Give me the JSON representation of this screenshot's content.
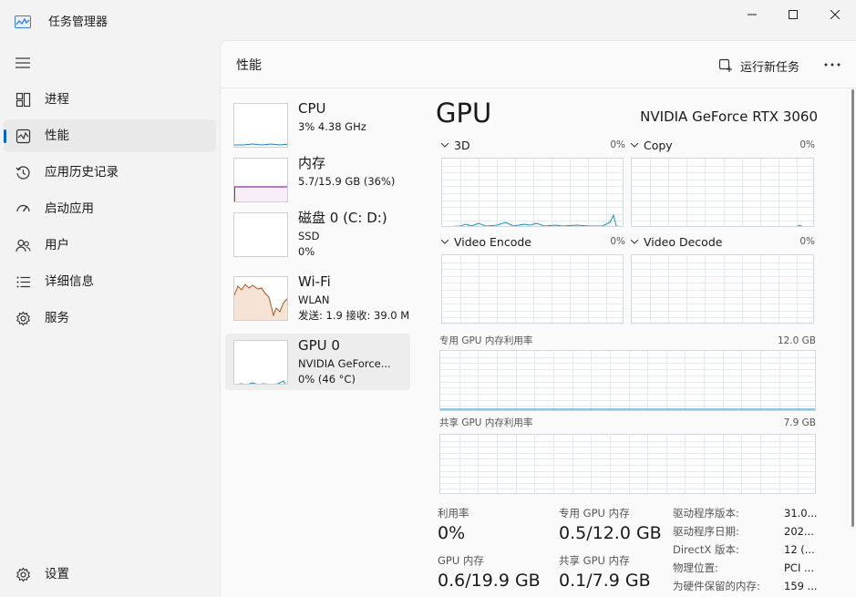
{
  "window": {
    "title": "任务管理器"
  },
  "sidebar": {
    "items": [
      {
        "label": "进程",
        "icon": "processes-icon"
      },
      {
        "label": "性能",
        "icon": "performance-icon",
        "active": true
      },
      {
        "label": "应用历史记录",
        "icon": "app-history-icon"
      },
      {
        "label": "启动应用",
        "icon": "startup-apps-icon"
      },
      {
        "label": "用户",
        "icon": "users-icon"
      },
      {
        "label": "详细信息",
        "icon": "details-icon"
      },
      {
        "label": "服务",
        "icon": "services-icon"
      }
    ],
    "settings_label": "设置"
  },
  "header": {
    "title": "性能",
    "run_task_label": "运行新任务"
  },
  "devices": [
    {
      "name": "CPU",
      "sub1": "3%  4.38 GHz",
      "sub2": "",
      "color": "#1f7fb8"
    },
    {
      "name": "内存",
      "sub1": "5.7/15.9 GB (36%)",
      "sub2": "",
      "color": "#8b2fa8"
    },
    {
      "name": "磁盘 0 (C: D:)",
      "sub1": "SSD",
      "sub2": "0%",
      "color": "#4c9a2a"
    },
    {
      "name": "Wi-Fi",
      "sub1": "WLAN",
      "sub2": "发送: 1.9  接收: 39.0 M",
      "color": "#a6541e"
    },
    {
      "name": "GPU 0",
      "sub1": "NVIDIA GeForce...",
      "sub2": "0% (46 °C)",
      "color": "#1f8fb8",
      "selected": true
    }
  ],
  "gpu": {
    "title": "GPU",
    "model": "NVIDIA GeForce RTX 3060",
    "engines": [
      {
        "name": "3D",
        "percent": "0%"
      },
      {
        "name": "Copy",
        "percent": "0%"
      },
      {
        "name": "Video Encode",
        "percent": "0%"
      },
      {
        "name": "Video Decode",
        "percent": "0%"
      }
    ],
    "dedicated_label": "专用 GPU 内存利用率",
    "dedicated_max": "12.0 GB",
    "shared_label": "共享 GPU 内存利用率",
    "shared_max": "7.9 GB",
    "stats": {
      "util_label": "利用率",
      "util_value": "0%",
      "ded_mem_label": "专用 GPU 内存",
      "ded_mem_value": "0.5/12.0 GB",
      "gpu_mem_label": "GPU 内存",
      "gpu_mem_value": "0.6/19.9 GB",
      "shared_mem_label": "共享 GPU 内存",
      "shared_mem_value": "0.1/7.9 GB"
    },
    "info": [
      {
        "key": "驱动程序版本:",
        "value": "31.0..."
      },
      {
        "key": "驱动程序日期:",
        "value": "202..."
      },
      {
        "key": "DirectX 版本:",
        "value": "12 (..."
      },
      {
        "key": "物理位置:",
        "value": "PCI ..."
      },
      {
        "key": "为硬件保留的内存:",
        "value": "159 ..."
      }
    ]
  },
  "colors": {
    "accent": "#0067c0",
    "gpu_line": "#1f8fb8",
    "grid": "#e4eaef"
  }
}
